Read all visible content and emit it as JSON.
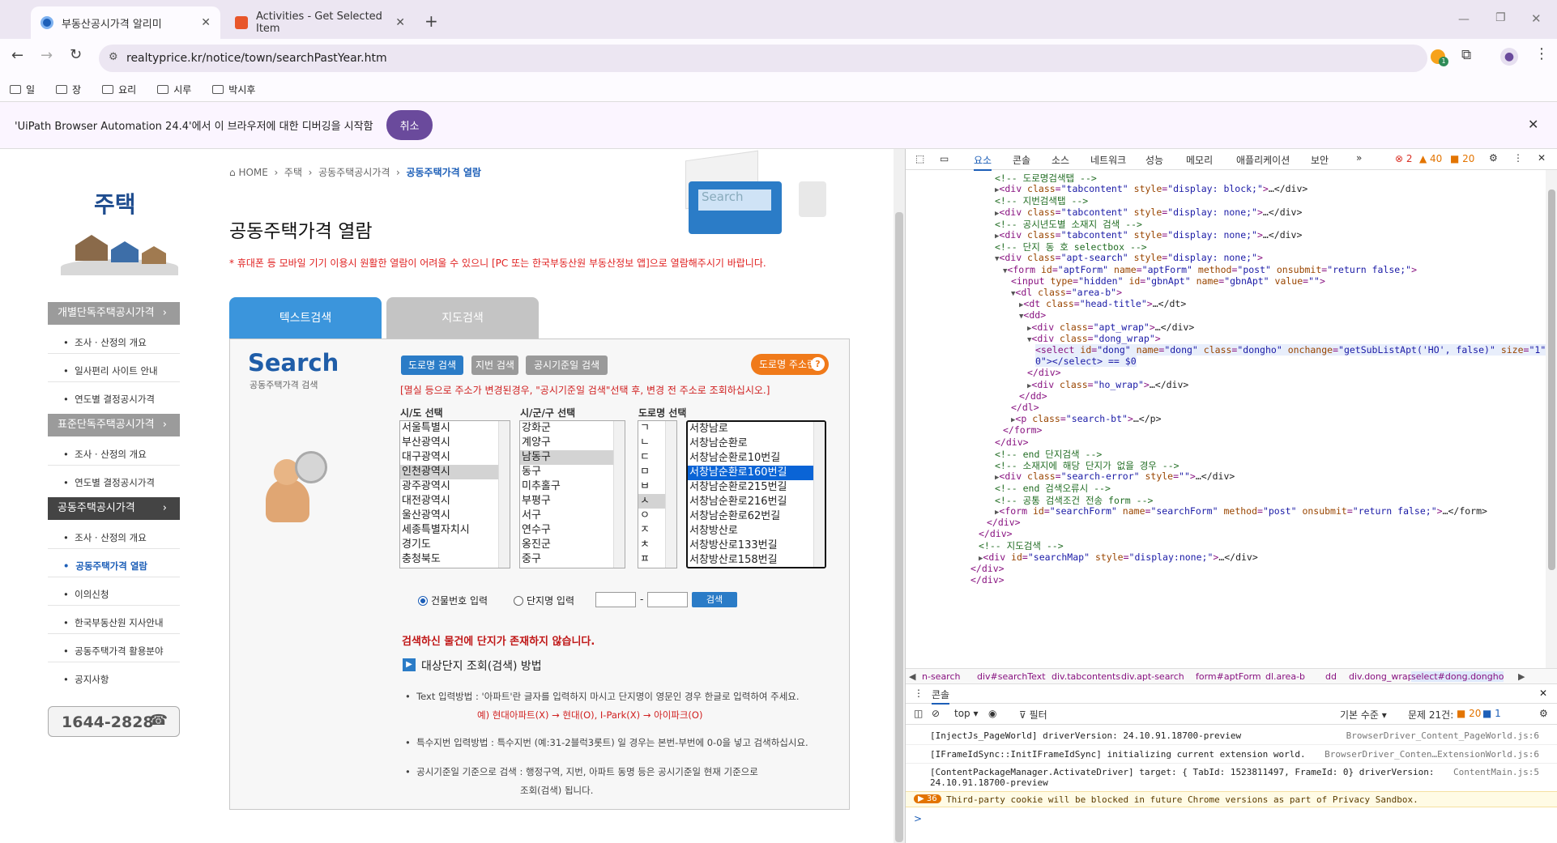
{
  "browser": {
    "tabs": [
      {
        "title": "부동산공시가격 알리미",
        "active": true
      },
      {
        "title": "Activities - Get Selected Item",
        "active": false
      }
    ],
    "new_tab": "+",
    "url": "realtyprice.kr/notice/town/searchPastYear.htm",
    "bookmarks": [
      "일",
      "장",
      "요리",
      "시루",
      "박시후"
    ],
    "extension_badge": "1",
    "infobar": {
      "message": "'UiPath Browser Automation 24.4'에서 이 브라우저에 대한 디버깅을 시작함",
      "cancel": "취소"
    }
  },
  "site": {
    "category": "주택",
    "breadcrumb": [
      "HOME",
      "주택",
      "공동주택공시가격",
      "공동주택가격 열람"
    ],
    "page_title": "공동주택가격 열람",
    "notice": "* 휴대폰 등 모바일 기기 이용시 원활한 열람이 어려울 수 있으니 [PC 또는 한국부동산원 부동산정보 앱]으로 열람해주시기 바랍니다.",
    "sidebar": {
      "groups": [
        {
          "title": "개별단독주택공시가격",
          "links": [
            "조사 · 산정의 개요",
            "일사편리 사이트 안내",
            "연도별 결정공시가격"
          ]
        },
        {
          "title": "표준단독주택공시가격",
          "links": [
            "조사 · 산정의 개요",
            "연도별 결정공시가격"
          ]
        },
        {
          "title": "공동주택공시가격",
          "links": [
            "조사 · 산정의 개요",
            "공동주택가격 열람",
            "이의신청",
            "한국부동산원 지사안내",
            "공동주택가격 활용분야",
            "공지사항"
          ]
        }
      ],
      "phone": "1644-2828"
    },
    "tabs": [
      "텍스트검색",
      "지도검색"
    ],
    "search_title": "Search",
    "search_subtitle": "공동주택가격 검색",
    "search_buttons": [
      "도로명 검색",
      "지번 검색",
      "공시기준일 검색"
    ],
    "road_help": "도로명 주소란",
    "warning": "[멸실 등으로 주소가 변경된경우, \"공시기준일 검색\"선택 후, 변경 전 주소로 조회하십시오.]",
    "column_labels": [
      "시/도 선택",
      "시/군/구 선택",
      "도로명 선택"
    ],
    "sido": [
      "서울특별시",
      "부산광역시",
      "대구광역시",
      "인천광역시",
      "광주광역시",
      "대전광역시",
      "울산광역시",
      "세종특별자치시",
      "경기도",
      "충청북도"
    ],
    "sigungu": [
      "강화군",
      "계양구",
      "남동구",
      "동구",
      "미추홀구",
      "부평구",
      "서구",
      "연수구",
      "옹진군",
      "중구"
    ],
    "initial": [
      "ㄱ",
      "ㄴ",
      "ㄷ",
      "ㅁ",
      "ㅂ",
      "ㅅ",
      "ㅇ",
      "ㅈ",
      "ㅊ",
      "ㅍ"
    ],
    "roads": [
      "서창남로",
      "서창남순환로",
      "서창남순환로10번길",
      "서창남순환로160번길",
      "서창남순환로215번길",
      "서창남순환로216번길",
      "서창남순환로62번길",
      "서창방산로",
      "서창방산로133번길",
      "서창방산로158번길"
    ],
    "radio": [
      "건물번호 입력",
      "단지명 입력"
    ],
    "dash": "-",
    "search_btn": "검색",
    "no_result": "검색하신 물건에 단지가 존재하지 않습니다.",
    "howto_title": "대상단지 조회(검색) 방법",
    "howto": [
      {
        "label": "Text 입력방법 :",
        "text": "'아파트'란 글자를 입력하지 마시고 단지명이 영문인 경우 한글로 입력하여 주세요.",
        "example": "예) 현대아파트(X) → 현대(O), I-Park(X) → 아이파크(O)"
      },
      {
        "label": "특수지번 입력방법 :",
        "text": "특수지번 (예:31-2블럭3롯트) 일 경우는 본번-부번에 0-0을 넣고 검색하십시요."
      },
      {
        "label": "공시기준일 기준으로 검색 :",
        "text": "행정구역, 지번, 아파트 동명 등은 공시기준일 현재 기준으로",
        "text2": "조회(검색) 됩니다."
      }
    ]
  },
  "devtools": {
    "tabs": [
      "요소",
      "콘솔",
      "소스",
      "네트워크",
      "성능",
      "메모리",
      "애플리케이션",
      "보안"
    ],
    "errors": "2",
    "warnings": "40",
    "info": "20",
    "dom": [
      {
        "i": 9,
        "html": "<!-- 도로명검색탭 -->",
        "t": "c"
      },
      {
        "i": 9,
        "tri": "▶",
        "tag": "div",
        "attrs": [
          [
            "class",
            "tabcontent"
          ],
          [
            "style",
            "display: block;"
          ]
        ],
        "end": "…</div>"
      },
      {
        "i": 9,
        "html": "<!-- 지번검색탭 -->",
        "t": "c"
      },
      {
        "i": 9,
        "tri": "▶",
        "tag": "div",
        "attrs": [
          [
            "class",
            "tabcontent"
          ],
          [
            "style",
            "display: none;"
          ]
        ],
        "end": "…</div>"
      },
      {
        "i": 9,
        "html": "<!-- 공시년도별 소재지 검색 -->",
        "t": "c"
      },
      {
        "i": 9,
        "tri": "▶",
        "tag": "div",
        "attrs": [
          [
            "class",
            "tabcontent"
          ],
          [
            "style",
            "display: none;"
          ]
        ],
        "end": "…</div>"
      },
      {
        "i": 9,
        "html": "<!-- 단지 동 호 selectbox -->",
        "t": "c"
      },
      {
        "i": 9,
        "tri": "▼",
        "tag": "div",
        "attrs": [
          [
            "class",
            "apt-search"
          ],
          [
            "style",
            "display: none;"
          ]
        ],
        "end": ""
      },
      {
        "i": 10,
        "tri": "▼",
        "tag": "form",
        "attrs": [
          [
            "id",
            "aptForm"
          ],
          [
            "name",
            "aptForm"
          ],
          [
            "method",
            "post"
          ],
          [
            "onsubmit",
            "return false;"
          ]
        ],
        "end": ""
      },
      {
        "i": 11,
        "tag": "input",
        "attrs": [
          [
            "type",
            "hidden"
          ],
          [
            "id",
            "gbnApt"
          ],
          [
            "name",
            "gbnApt"
          ],
          [
            "value",
            ""
          ]
        ],
        "end": ""
      },
      {
        "i": 11,
        "tri": "▼",
        "tag": "dl",
        "attrs": [
          [
            "class",
            "area-b"
          ]
        ],
        "end": ""
      },
      {
        "i": 12,
        "tri": "▶",
        "tag": "dt",
        "attrs": [
          [
            "class",
            "head-title"
          ]
        ],
        "end": "…</dt>"
      },
      {
        "i": 12,
        "tri": "▼",
        "tag": "dd",
        "attrs": [],
        "end": ""
      },
      {
        "i": 13,
        "tri": "▶",
        "tag": "div",
        "attrs": [
          [
            "class",
            "apt_wrap"
          ]
        ],
        "end": "…</div>"
      },
      {
        "i": 13,
        "tri": "▼",
        "tag": "div",
        "attrs": [
          [
            "class",
            "dong_wrap"
          ]
        ],
        "end": ""
      },
      {
        "i": 14,
        "tag": "select",
        "attrs": [
          [
            "id",
            "dong"
          ],
          [
            "name",
            "dong"
          ],
          [
            "class",
            "dongho"
          ],
          [
            "onchange",
            "getSubListApt('HO', false)"
          ],
          [
            "size",
            "1"
          ]
        ],
        "end": ""
      },
      {
        "i": 14,
        "html": "0\"></select> == $0",
        "t": "x"
      },
      {
        "i": 13,
        "html": "</div>",
        "t": "t"
      },
      {
        "i": 13,
        "tri": "▶",
        "tag": "div",
        "attrs": [
          [
            "class",
            "ho_wrap"
          ]
        ],
        "end": "…</div>"
      },
      {
        "i": 12,
        "html": "</dd>",
        "t": "t"
      },
      {
        "i": 11,
        "html": "</dl>",
        "t": "t"
      },
      {
        "i": 11,
        "tri": "▶",
        "tag": "p",
        "attrs": [
          [
            "class",
            "search-bt"
          ]
        ],
        "end": "…</p>"
      },
      {
        "i": 10,
        "html": "</form>",
        "t": "t"
      },
      {
        "i": 9,
        "html": "</div>",
        "t": "t"
      },
      {
        "i": 9,
        "html": "<!-- end 단지검색 -->",
        "t": "c"
      },
      {
        "i": 9,
        "html": "<!-- 소재지에 해당 단지가 없을 경우 -->",
        "t": "c"
      },
      {
        "i": 9,
        "tri": "▶",
        "tag": "div",
        "attrs": [
          [
            "class",
            "search-error"
          ],
          [
            "style",
            ""
          ]
        ],
        "end": "…</div>"
      },
      {
        "i": 9,
        "html": "<!-- end 검색오류시 -->",
        "t": "c"
      },
      {
        "i": 9,
        "html": "<!-- 공통 검색조건 전송 form -->",
        "t": "c"
      },
      {
        "i": 9,
        "tri": "▶",
        "tag": "form",
        "attrs": [
          [
            "id",
            "searchForm"
          ],
          [
            "name",
            "searchForm"
          ],
          [
            "method",
            "post"
          ],
          [
            "onsubmit",
            "return false;"
          ]
        ],
        "end": "…</form>"
      },
      {
        "i": 8,
        "html": "</div>",
        "t": "t"
      },
      {
        "i": 7,
        "html": "</div>",
        "t": "t"
      },
      {
        "i": 7,
        "html": "<!-- 지도검색 -->",
        "t": "c"
      },
      {
        "i": 7,
        "tri": "▶",
        "tag": "div",
        "attrs": [
          [
            "id",
            "searchMap"
          ],
          [
            "style",
            "display:none;"
          ]
        ],
        "end": "…</div>"
      },
      {
        "i": 6,
        "html": "</div>",
        "t": "t"
      },
      {
        "i": 6,
        "html": "</div>",
        "t": "t"
      }
    ],
    "breadcrumbs": [
      "n-search",
      "div#searchText",
      "div.tabcontents",
      "div.apt-search",
      "form#aptForm",
      "dl.area-b",
      "dd",
      "div.dong_wrap",
      "select#dong.dongho"
    ],
    "console_tab": "콘솔",
    "console_context": "top",
    "filter": "필터",
    "level": "기본 수준",
    "issues": "문제 21건:",
    "issue_warn": "20",
    "issue_info": "1",
    "console": [
      {
        "msg": "[InjectJs_PageWorld] driverVersion: 24.10.91.18700-preview",
        "src": "BrowserDriver_Content_PageWorld.js:6"
      },
      {
        "msg": "[IFrameIdSync::InitIFrameIdSync] initializing current extension world.",
        "src": "BrowserDriver_Conten…ExtensionWorld.js:6"
      },
      {
        "msg": "[ContentPackageManager.ActivateDriver] target: { TabId: 1523811497, FrameId: 0} driverVersion:",
        "msg2": "24.10.91.18700-preview",
        "src": "ContentMain.js:5"
      },
      {
        "msg": "Third-party cookie will be blocked in future Chrome versions as part of Privacy Sandbox.",
        "badge": "36",
        "warn": true
      }
    ],
    "prompt": ">"
  }
}
